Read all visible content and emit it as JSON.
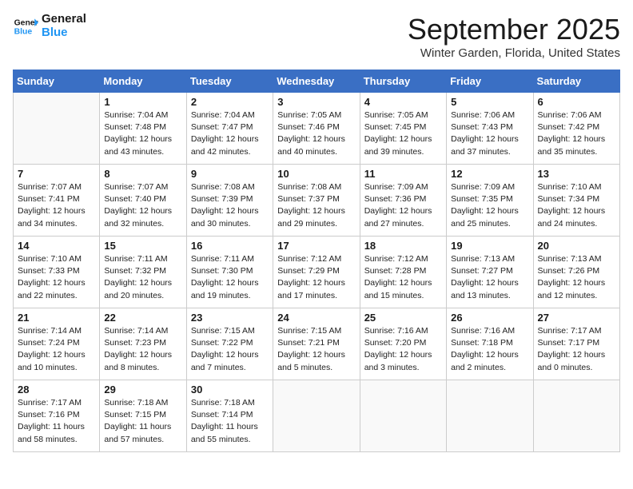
{
  "header": {
    "logo_line1": "General",
    "logo_line2": "Blue",
    "month": "September 2025",
    "location": "Winter Garden, Florida, United States"
  },
  "weekdays": [
    "Sunday",
    "Monday",
    "Tuesday",
    "Wednesday",
    "Thursday",
    "Friday",
    "Saturday"
  ],
  "weeks": [
    [
      {
        "day": "",
        "details": ""
      },
      {
        "day": "1",
        "details": "Sunrise: 7:04 AM\nSunset: 7:48 PM\nDaylight: 12 hours\nand 43 minutes."
      },
      {
        "day": "2",
        "details": "Sunrise: 7:04 AM\nSunset: 7:47 PM\nDaylight: 12 hours\nand 42 minutes."
      },
      {
        "day": "3",
        "details": "Sunrise: 7:05 AM\nSunset: 7:46 PM\nDaylight: 12 hours\nand 40 minutes."
      },
      {
        "day": "4",
        "details": "Sunrise: 7:05 AM\nSunset: 7:45 PM\nDaylight: 12 hours\nand 39 minutes."
      },
      {
        "day": "5",
        "details": "Sunrise: 7:06 AM\nSunset: 7:43 PM\nDaylight: 12 hours\nand 37 minutes."
      },
      {
        "day": "6",
        "details": "Sunrise: 7:06 AM\nSunset: 7:42 PM\nDaylight: 12 hours\nand 35 minutes."
      }
    ],
    [
      {
        "day": "7",
        "details": "Sunrise: 7:07 AM\nSunset: 7:41 PM\nDaylight: 12 hours\nand 34 minutes."
      },
      {
        "day": "8",
        "details": "Sunrise: 7:07 AM\nSunset: 7:40 PM\nDaylight: 12 hours\nand 32 minutes."
      },
      {
        "day": "9",
        "details": "Sunrise: 7:08 AM\nSunset: 7:39 PM\nDaylight: 12 hours\nand 30 minutes."
      },
      {
        "day": "10",
        "details": "Sunrise: 7:08 AM\nSunset: 7:37 PM\nDaylight: 12 hours\nand 29 minutes."
      },
      {
        "day": "11",
        "details": "Sunrise: 7:09 AM\nSunset: 7:36 PM\nDaylight: 12 hours\nand 27 minutes."
      },
      {
        "day": "12",
        "details": "Sunrise: 7:09 AM\nSunset: 7:35 PM\nDaylight: 12 hours\nand 25 minutes."
      },
      {
        "day": "13",
        "details": "Sunrise: 7:10 AM\nSunset: 7:34 PM\nDaylight: 12 hours\nand 24 minutes."
      }
    ],
    [
      {
        "day": "14",
        "details": "Sunrise: 7:10 AM\nSunset: 7:33 PM\nDaylight: 12 hours\nand 22 minutes."
      },
      {
        "day": "15",
        "details": "Sunrise: 7:11 AM\nSunset: 7:32 PM\nDaylight: 12 hours\nand 20 minutes."
      },
      {
        "day": "16",
        "details": "Sunrise: 7:11 AM\nSunset: 7:30 PM\nDaylight: 12 hours\nand 19 minutes."
      },
      {
        "day": "17",
        "details": "Sunrise: 7:12 AM\nSunset: 7:29 PM\nDaylight: 12 hours\nand 17 minutes."
      },
      {
        "day": "18",
        "details": "Sunrise: 7:12 AM\nSunset: 7:28 PM\nDaylight: 12 hours\nand 15 minutes."
      },
      {
        "day": "19",
        "details": "Sunrise: 7:13 AM\nSunset: 7:27 PM\nDaylight: 12 hours\nand 13 minutes."
      },
      {
        "day": "20",
        "details": "Sunrise: 7:13 AM\nSunset: 7:26 PM\nDaylight: 12 hours\nand 12 minutes."
      }
    ],
    [
      {
        "day": "21",
        "details": "Sunrise: 7:14 AM\nSunset: 7:24 PM\nDaylight: 12 hours\nand 10 minutes."
      },
      {
        "day": "22",
        "details": "Sunrise: 7:14 AM\nSunset: 7:23 PM\nDaylight: 12 hours\nand 8 minutes."
      },
      {
        "day": "23",
        "details": "Sunrise: 7:15 AM\nSunset: 7:22 PM\nDaylight: 12 hours\nand 7 minutes."
      },
      {
        "day": "24",
        "details": "Sunrise: 7:15 AM\nSunset: 7:21 PM\nDaylight: 12 hours\nand 5 minutes."
      },
      {
        "day": "25",
        "details": "Sunrise: 7:16 AM\nSunset: 7:20 PM\nDaylight: 12 hours\nand 3 minutes."
      },
      {
        "day": "26",
        "details": "Sunrise: 7:16 AM\nSunset: 7:18 PM\nDaylight: 12 hours\nand 2 minutes."
      },
      {
        "day": "27",
        "details": "Sunrise: 7:17 AM\nSunset: 7:17 PM\nDaylight: 12 hours\nand 0 minutes."
      }
    ],
    [
      {
        "day": "28",
        "details": "Sunrise: 7:17 AM\nSunset: 7:16 PM\nDaylight: 11 hours\nand 58 minutes."
      },
      {
        "day": "29",
        "details": "Sunrise: 7:18 AM\nSunset: 7:15 PM\nDaylight: 11 hours\nand 57 minutes."
      },
      {
        "day": "30",
        "details": "Sunrise: 7:18 AM\nSunset: 7:14 PM\nDaylight: 11 hours\nand 55 minutes."
      },
      {
        "day": "",
        "details": ""
      },
      {
        "day": "",
        "details": ""
      },
      {
        "day": "",
        "details": ""
      },
      {
        "day": "",
        "details": ""
      }
    ]
  ]
}
